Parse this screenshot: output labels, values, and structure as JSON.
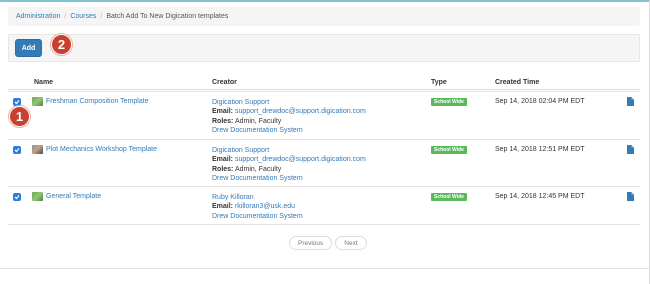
{
  "breadcrumb": {
    "item1": "Administration",
    "item2": "Courses",
    "current": "Batch Add To New Digication templates"
  },
  "toolbar": {
    "add_label": "Add"
  },
  "callouts": {
    "one": "1",
    "two": "2"
  },
  "table": {
    "headers": {
      "name": "Name",
      "creator": "Creator",
      "type": "Type",
      "created": "Created Time"
    },
    "rows": [
      {
        "name": "Freshman Composition Template",
        "creator_name": "Digication Support",
        "email_label": "Email:",
        "email": "support_drewdoc@support.digication.com",
        "roles_label": "Roles:",
        "roles": "Admin, Faculty",
        "system": "Drew Documentation System",
        "type": "School Wide",
        "created": "Sep 14, 2018 02:04 PM EDT"
      },
      {
        "name": "Plot Mechanics Workshop Template",
        "creator_name": "Digication Support",
        "email_label": "Email:",
        "email": "support_drewdoc@support.digication.com",
        "roles_label": "Roles:",
        "roles": "Admin, Faculty",
        "system": "Drew Documentation System",
        "type": "School Wide",
        "created": "Sep 14, 2018 12:51 PM EDT"
      },
      {
        "name": "General Template",
        "creator_name": "Ruby Killoran",
        "email_label": "Email:",
        "email": "rkilloran3@usk.edu",
        "system": "Drew Documentation System",
        "type": "School Wide",
        "created": "Sep 14, 2018 12:45 PM EDT"
      }
    ]
  },
  "pagination": {
    "previous": "Previous",
    "next": "Next"
  },
  "icons": {
    "checkbox": "checkbox-checked-icon",
    "document": "document-icon",
    "thumbnail": "template-thumbnail-icon"
  },
  "colors": {
    "accent": "#337ab7",
    "badge": "#5cb85c",
    "callout": "#c8402e",
    "checkbox": "#2d7ddd"
  }
}
